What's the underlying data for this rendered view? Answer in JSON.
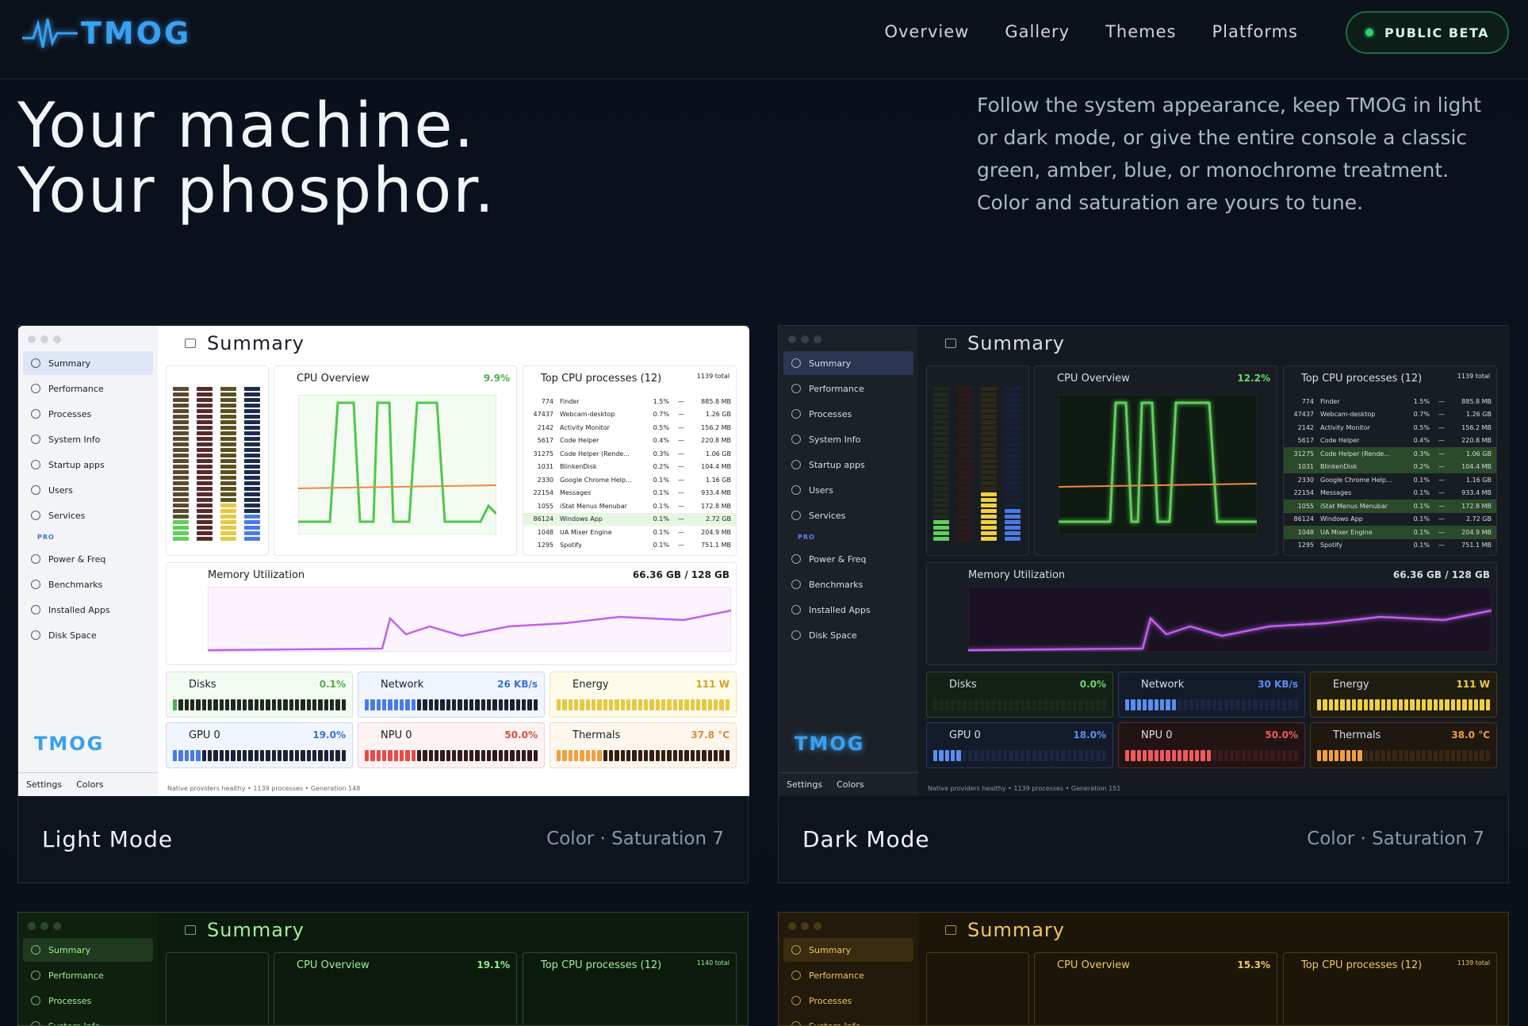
{
  "nav": {
    "logo_text": "TMOG",
    "links": [
      "Overview",
      "Gallery",
      "Themes",
      "Platforms"
    ],
    "beta_label": "PUBLIC BETA"
  },
  "hero": {
    "title_line1": "Your machine.",
    "title_line2": "Your phosphor.",
    "copy": "Follow the system appearance, keep TMOG in light or dark mode, or give the entire console a classic green, amber, blue, or monochrome treatment. Color and saturation are yours to tune."
  },
  "cards": [
    {
      "mode": "Light Mode",
      "meta": "Color · Saturation 7",
      "cpu_pct": "9.9%",
      "mem": "66.36 GB / 128 GB",
      "net": "26 KB/s",
      "energy": "111 W",
      "disks": "0.1%",
      "gpu": "19.0%",
      "npu": "50.0%",
      "thermals": "37.8 °C",
      "generation": "Native providers healthy • 1139 processes • Generation 148"
    },
    {
      "mode": "Dark Mode",
      "meta": "Color · Saturation 7",
      "cpu_pct": "12.2%",
      "mem": "66.36 GB / 128 GB",
      "net": "30 KB/s",
      "energy": "111 W",
      "disks": "0.0%",
      "gpu": "18.0%",
      "npu": "50.0%",
      "thermals": "38.0 °C",
      "generation": "Native providers healthy • 1139 processes • Generation 151"
    },
    {
      "cpu_pct": "19.1%"
    },
    {
      "cpu_pct": "15.3%"
    }
  ],
  "app": {
    "summary": "Summary",
    "cpu_overview": "CPU Overview",
    "top_cpu": "Top CPU processes (12)",
    "total_light": "1139 total",
    "total_green": "1140 total",
    "memory_util": "Memory Utilization",
    "disks": "Disks",
    "network": "Network",
    "energy": "Energy",
    "gpu0": "GPU 0",
    "npu0": "NPU 0",
    "thermals": "Thermals",
    "settings": "Settings",
    "colors": "Colors",
    "pro": "PRO",
    "sidebar": [
      "Summary",
      "Performance",
      "Processes",
      "System Info",
      "Startup apps",
      "Users",
      "Services"
    ],
    "sidebar_pro": [
      "Power & Freq",
      "Benchmarks",
      "Installed Apps",
      "Disk Space"
    ],
    "procs": [
      [
        "774",
        "Finder",
        "1.5%",
        "—",
        "885.8 MB"
      ],
      [
        "47437",
        "Webcam-desktop",
        "0.7%",
        "—",
        "1.26 GB"
      ],
      [
        "2142",
        "Activity Monitor",
        "0.5%",
        "—",
        "156.2 MB"
      ],
      [
        "5617",
        "Code Helper",
        "0.4%",
        "—",
        "220.8 MB"
      ],
      [
        "31275",
        "Code Helper (Rende...",
        "0.3%",
        "—",
        "1.06 GB"
      ],
      [
        "1031",
        "BlinkenDisk",
        "0.2%",
        "—",
        "104.4 MB"
      ],
      [
        "2330",
        "Google Chrome Help...",
        "0.1%",
        "—",
        "1.16 GB"
      ],
      [
        "22154",
        "Messages",
        "0.1%",
        "—",
        "933.4 MB"
      ],
      [
        "1055",
        "iStat Menus Menubar",
        "0.1%",
        "—",
        "172.8 MB"
      ],
      [
        "86124",
        "Windows App",
        "0.1%",
        "—",
        "2.72 GB"
      ],
      [
        "1048",
        "UA Mixer Engine",
        "0.1%",
        "—",
        "204.9 MB"
      ],
      [
        "1295",
        "Spotify",
        "0.1%",
        "—",
        "751.1 MB"
      ]
    ]
  },
  "colors": {
    "accent_blue": "#3aa0f0",
    "beta_green": "#2fd070",
    "cpu_green": "#5fd05a",
    "memory_purple": "#c060f0"
  }
}
